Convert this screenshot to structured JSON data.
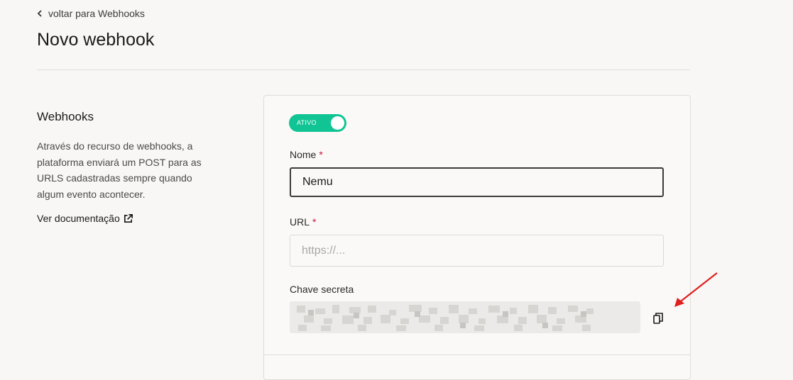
{
  "header": {
    "back_label": "voltar para Webhooks",
    "title": "Novo webhook"
  },
  "sidebar": {
    "title": "Webhooks",
    "description": "Através do recurso de webhooks, a plataforma enviará um POST para as URLS cadastradas sempre quando algum evento acontecer.",
    "doc_link": "Ver documentação"
  },
  "form": {
    "toggle_label": "ATIVO",
    "name_label": "Nome",
    "name_value": "Nemu",
    "url_label": "URL",
    "url_placeholder": "https://...",
    "secret_label": "Chave secreta",
    "required_mark": "*"
  },
  "colors": {
    "accent": "#10c494",
    "required": "#d0103a",
    "annotation_arrow": "#e0201e"
  },
  "icons": {
    "back": "chevron-left-icon",
    "external": "external-link-icon",
    "copy": "copy-icon"
  }
}
